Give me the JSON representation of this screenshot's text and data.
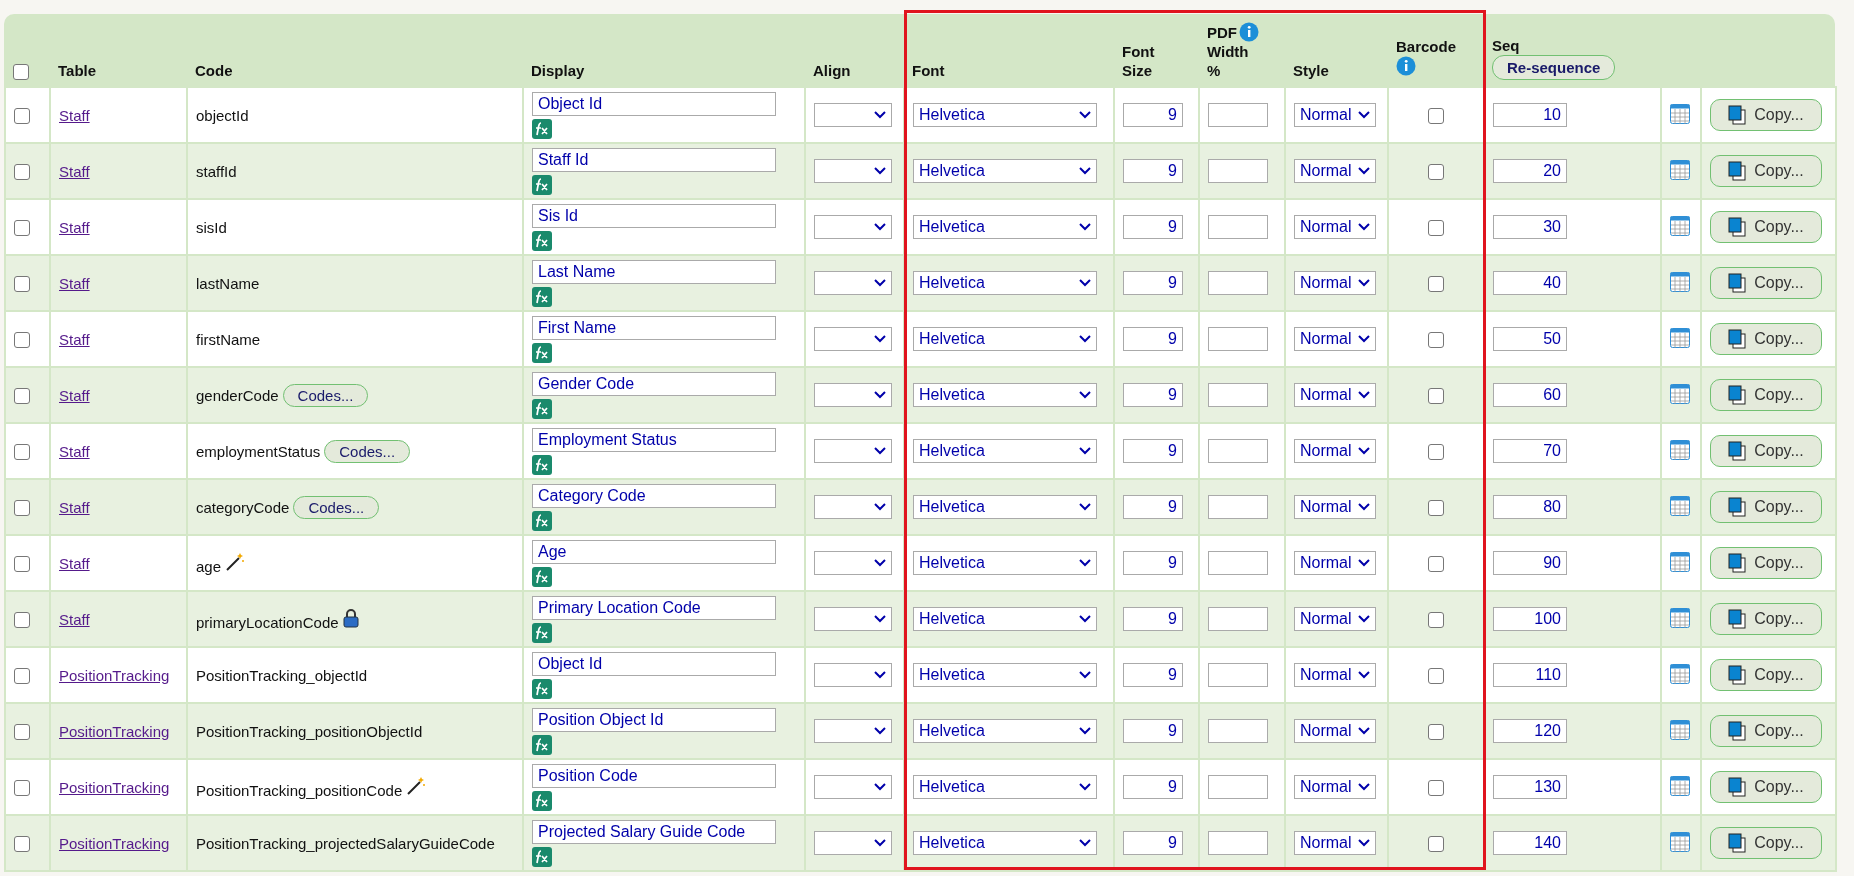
{
  "header": {
    "select_all": {
      "checked": false
    },
    "columns": {
      "table": "Table",
      "code": "Code",
      "display": "Display",
      "align": "Align",
      "font": "Font",
      "font_size": [
        "Font",
        "Size"
      ],
      "pdf_width": [
        "PDF",
        "Width",
        "%"
      ],
      "style": "Style",
      "barcode": "Barcode",
      "seq": "Seq"
    },
    "resequence_button": "Re-sequence"
  },
  "rows": [
    {
      "checked": false,
      "table": "Staff",
      "code": "objectId",
      "display": "Object Id",
      "font": "Helvetica",
      "font_size": "9",
      "style": "Normal",
      "barcode": false,
      "seq": "10",
      "copy": "Copy..."
    },
    {
      "checked": false,
      "table": "Staff",
      "code": "staffId",
      "display": "Staff Id",
      "font": "Helvetica",
      "font_size": "9",
      "style": "Normal",
      "barcode": false,
      "seq": "20",
      "copy": "Copy..."
    },
    {
      "checked": false,
      "table": "Staff",
      "code": "sisId",
      "display": "Sis Id",
      "font": "Helvetica",
      "font_size": "9",
      "style": "Normal",
      "barcode": false,
      "seq": "30",
      "copy": "Copy..."
    },
    {
      "checked": false,
      "table": "Staff",
      "code": "lastName",
      "display": "Last Name",
      "font": "Helvetica",
      "font_size": "9",
      "style": "Normal",
      "barcode": false,
      "seq": "40",
      "copy": "Copy..."
    },
    {
      "checked": false,
      "table": "Staff",
      "code": "firstName",
      "display": "First Name",
      "font": "Helvetica",
      "font_size": "9",
      "style": "Normal",
      "barcode": false,
      "seq": "50",
      "copy": "Copy..."
    },
    {
      "checked": false,
      "table": "Staff",
      "code": "genderCode",
      "codes_button": "Codes...",
      "display": "Gender Code",
      "font": "Helvetica",
      "font_size": "9",
      "style": "Normal",
      "barcode": false,
      "seq": "60",
      "copy": "Copy..."
    },
    {
      "checked": false,
      "table": "Staff",
      "code": "employmentStatus",
      "codes_button": "Codes...",
      "display": "Employment Status",
      "font": "Helvetica",
      "font_size": "9",
      "style": "Normal",
      "barcode": false,
      "seq": "70",
      "copy": "Copy..."
    },
    {
      "checked": false,
      "table": "Staff",
      "code": "categoryCode",
      "codes_button": "Codes...",
      "display": "Category Code",
      "font": "Helvetica",
      "font_size": "9",
      "style": "Normal",
      "barcode": false,
      "seq": "80",
      "copy": "Copy..."
    },
    {
      "checked": false,
      "table": "Staff",
      "code": "age",
      "kind": "wand",
      "display": "Age",
      "font": "Helvetica",
      "font_size": "9",
      "style": "Normal",
      "barcode": false,
      "seq": "90",
      "copy": "Copy..."
    },
    {
      "checked": false,
      "table": "Staff",
      "code": "primaryLocationCode",
      "kind": "lock",
      "display": "Primary Location Code",
      "font": "Helvetica",
      "font_size": "9",
      "style": "Normal",
      "barcode": false,
      "seq": "100",
      "copy": "Copy..."
    },
    {
      "checked": false,
      "table": "PositionTracking",
      "code": "PositionTracking_objectId",
      "display": "Object Id",
      "font": "Helvetica",
      "font_size": "9",
      "style": "Normal",
      "barcode": false,
      "seq": "110",
      "copy": "Copy..."
    },
    {
      "checked": false,
      "table": "PositionTracking",
      "code": "PositionTracking_positionObjectId",
      "display": "Position Object Id",
      "font": "Helvetica",
      "font_size": "9",
      "style": "Normal",
      "barcode": false,
      "seq": "120",
      "copy": "Copy..."
    },
    {
      "checked": false,
      "table": "PositionTracking",
      "code": "PositionTracking_positionCode",
      "kind": "wand",
      "display": "Position Code",
      "font": "Helvetica",
      "font_size": "9",
      "style": "Normal",
      "barcode": false,
      "seq": "130",
      "copy": "Copy..."
    },
    {
      "checked": false,
      "table": "PositionTracking",
      "code": "PositionTracking_projectedSalaryGuideCode",
      "display": "Projected Salary Guide Code",
      "font": "Helvetica",
      "font_size": "9",
      "style": "Normal",
      "barcode": false,
      "seq": "140",
      "copy": "Copy..."
    }
  ]
}
